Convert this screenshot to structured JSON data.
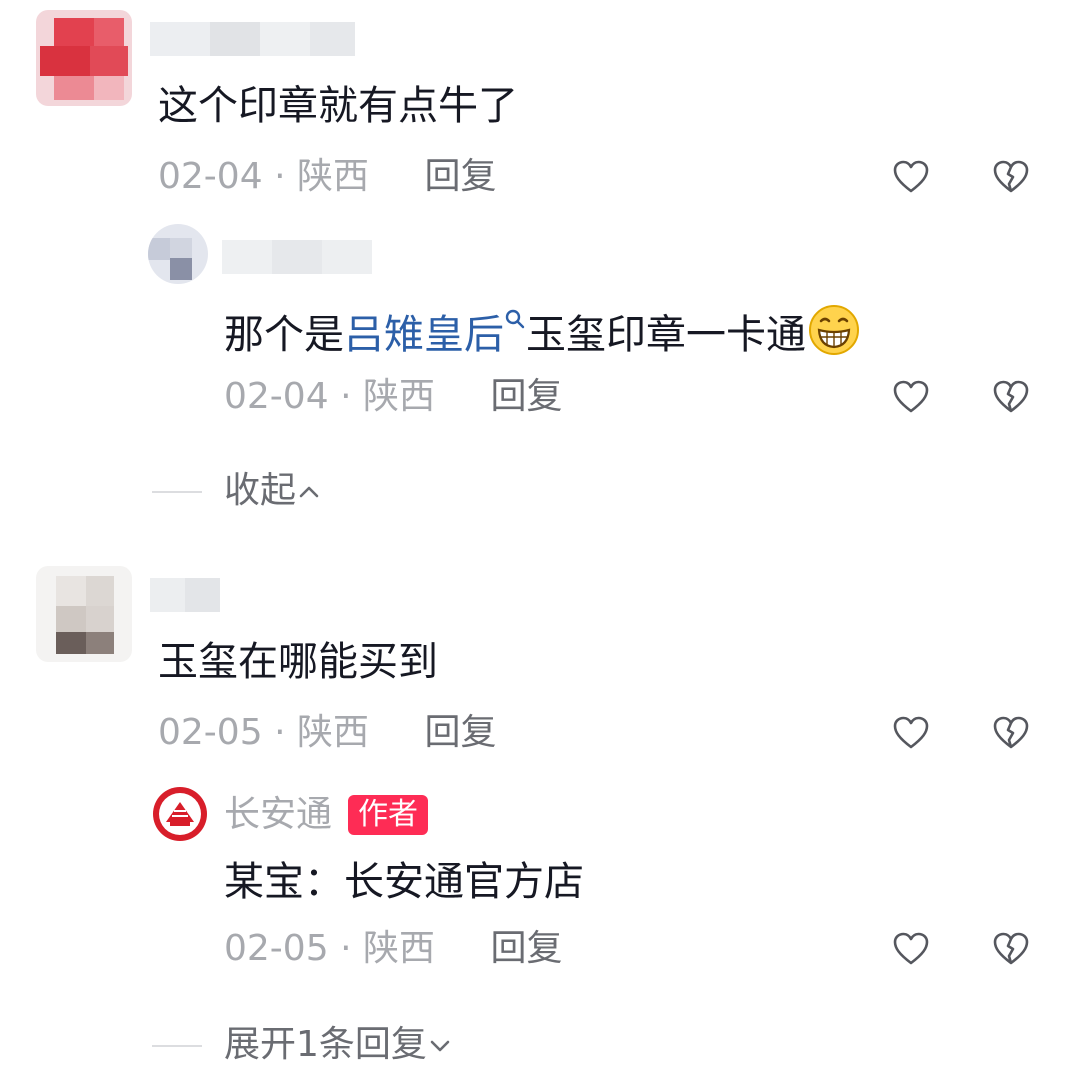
{
  "comments": [
    {
      "text": "这个印章就有点牛了",
      "date": "02-04",
      "sep": "·",
      "region": "陕西",
      "reply_label": "回复",
      "reply": {
        "text_pre": "那个是",
        "text_link": "吕雉皇后",
        "text_post": "玉玺印章一卡通",
        "date": "02-04",
        "sep": "·",
        "region": "陕西",
        "reply_label": "回复"
      },
      "collapse_label": "收起"
    },
    {
      "text": "玉玺在哪能买到",
      "date": "02-05",
      "sep": "·",
      "region": "陕西",
      "reply_label": "回复",
      "reply": {
        "author": "长安通",
        "author_badge": "作者",
        "text": "某宝：长安通官方店",
        "date": "02-05",
        "sep": "·",
        "region": "陕西",
        "reply_label": "回复"
      },
      "expand_label": "展开1条回复"
    }
  ],
  "icons": {
    "like": "heart-outline-icon",
    "dislike": "broken-heart-icon",
    "search": "search-icon",
    "emoji": "grinning-face-emoji",
    "collapse": "chevron-up-icon",
    "expand": "chevron-down-icon"
  },
  "colors": {
    "text": "#161823",
    "meta": "#a7a9ae",
    "link": "#2c5fa8",
    "badge": "#fe2c55"
  }
}
